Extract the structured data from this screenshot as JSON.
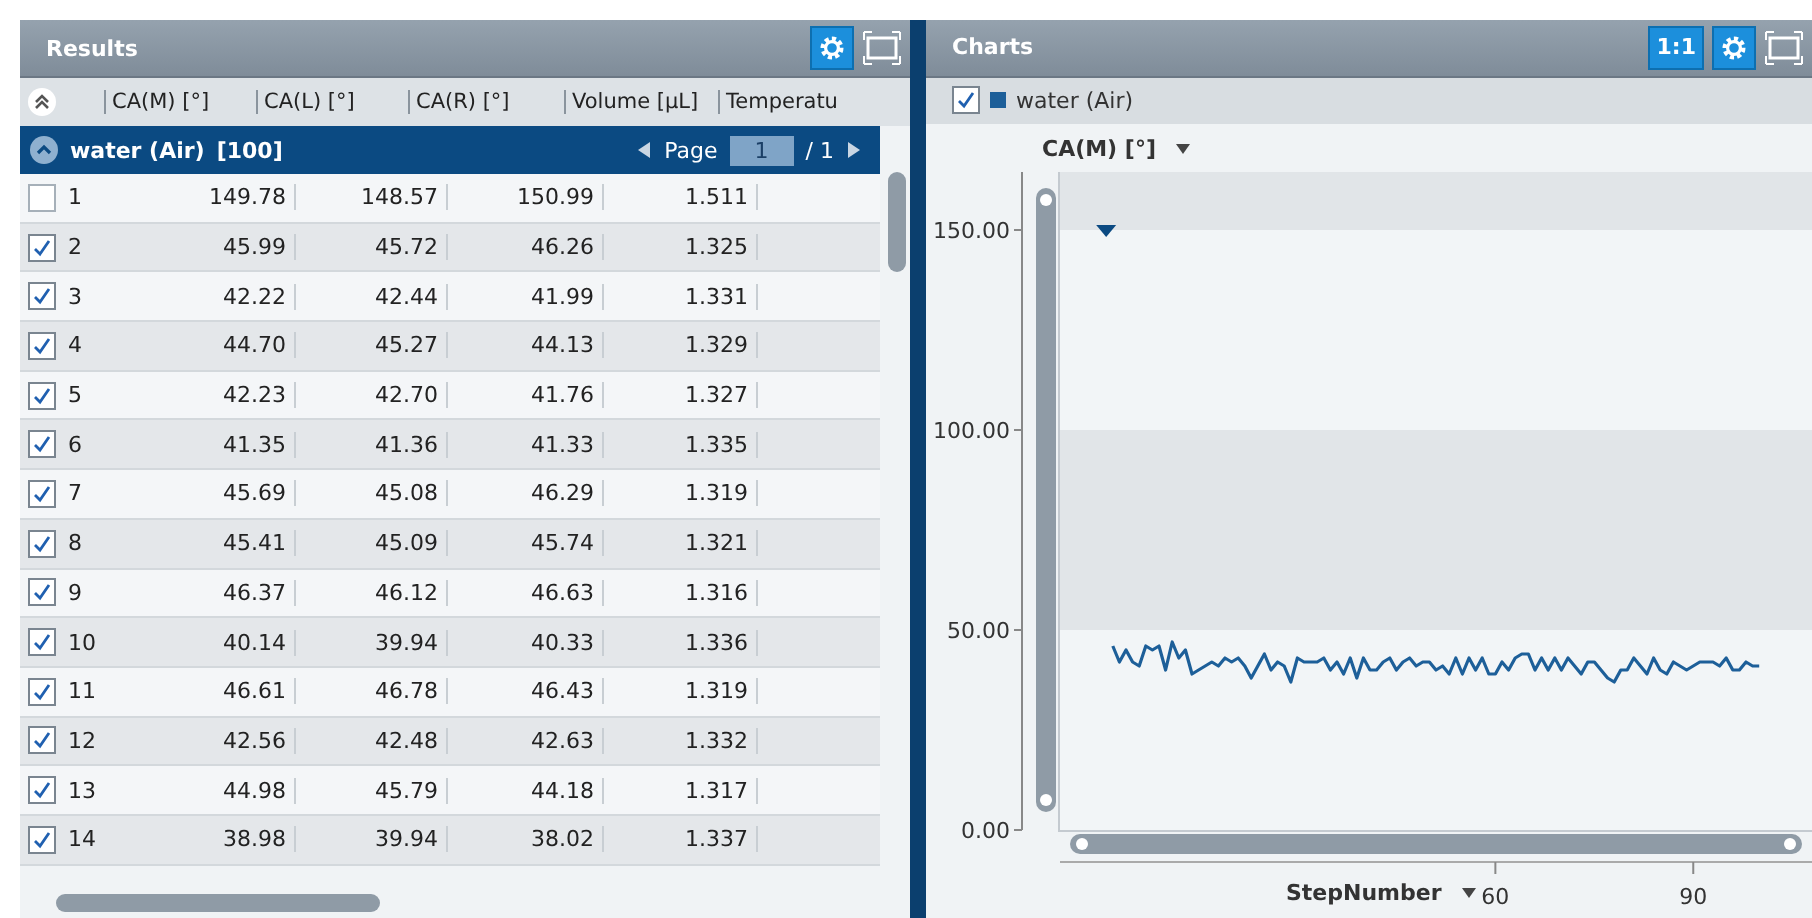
{
  "results_panel": {
    "title": "Results",
    "columns": [
      "CA(M) [°]",
      "CA(L) [°]",
      "CA(R) [°]",
      "Volume [µL]",
      "Temperatu"
    ],
    "group": {
      "label": "water (Air)",
      "count": "[100]",
      "page_label": "Page",
      "page": "1",
      "page_total": "/ 1"
    },
    "rows": [
      {
        "number": "1",
        "checked": false,
        "values": [
          "149.78",
          "148.57",
          "150.99",
          "1.511"
        ]
      },
      {
        "number": "2",
        "checked": true,
        "values": [
          "45.99",
          "45.72",
          "46.26",
          "1.325"
        ]
      },
      {
        "number": "3",
        "checked": true,
        "values": [
          "42.22",
          "42.44",
          "41.99",
          "1.331"
        ]
      },
      {
        "number": "4",
        "checked": true,
        "values": [
          "44.70",
          "45.27",
          "44.13",
          "1.329"
        ]
      },
      {
        "number": "5",
        "checked": true,
        "values": [
          "42.23",
          "42.70",
          "41.76",
          "1.327"
        ]
      },
      {
        "number": "6",
        "checked": true,
        "values": [
          "41.35",
          "41.36",
          "41.33",
          "1.335"
        ]
      },
      {
        "number": "7",
        "checked": true,
        "values": [
          "45.69",
          "45.08",
          "46.29",
          "1.319"
        ]
      },
      {
        "number": "8",
        "checked": true,
        "values": [
          "45.41",
          "45.09",
          "45.74",
          "1.321"
        ]
      },
      {
        "number": "9",
        "checked": true,
        "values": [
          "46.37",
          "46.12",
          "46.63",
          "1.316"
        ]
      },
      {
        "number": "10",
        "checked": true,
        "values": [
          "40.14",
          "39.94",
          "40.33",
          "1.336"
        ]
      },
      {
        "number": "11",
        "checked": true,
        "values": [
          "46.61",
          "46.78",
          "46.43",
          "1.319"
        ]
      },
      {
        "number": "12",
        "checked": true,
        "values": [
          "42.56",
          "42.48",
          "42.63",
          "1.332"
        ]
      },
      {
        "number": "13",
        "checked": true,
        "values": [
          "44.98",
          "45.79",
          "44.18",
          "1.317"
        ]
      },
      {
        "number": "14",
        "checked": true,
        "values": [
          "38.98",
          "39.94",
          "38.02",
          "1.337"
        ]
      }
    ]
  },
  "charts_panel": {
    "title": "Charts",
    "ratio_button": "1:1",
    "legend_checked": true,
    "y_selector": "CA(M) [°]",
    "x_selector": "StepNumber",
    "chart_data": {
      "type": "line",
      "xlim": [
        -6,
        108
      ],
      "ylim": [
        0,
        164.5
      ],
      "yticks": [
        {
          "value": 0,
          "label": "0.00"
        },
        {
          "value": 50,
          "label": "50.00"
        },
        {
          "value": 100,
          "label": "100.00"
        },
        {
          "value": 150,
          "label": "150.00"
        }
      ],
      "xticks": [
        60,
        90
      ],
      "x": [
        2,
        3,
        4,
        5,
        6,
        7,
        8,
        9,
        10,
        11,
        12,
        13,
        14,
        15,
        16,
        17,
        18,
        19,
        20,
        21,
        22,
        23,
        24,
        25,
        26,
        27,
        28,
        29,
        30,
        31,
        32,
        33,
        34,
        35,
        36,
        37,
        38,
        39,
        40,
        41,
        42,
        43,
        44,
        45,
        46,
        47,
        48,
        49,
        50,
        51,
        52,
        53,
        54,
        55,
        56,
        57,
        58,
        59,
        60,
        61,
        62,
        63,
        64,
        65,
        66,
        67,
        68,
        69,
        70,
        71,
        72,
        73,
        74,
        75,
        76,
        77,
        78,
        79,
        80,
        81,
        82,
        83,
        84,
        85,
        86,
        87,
        88,
        89,
        90,
        91,
        92,
        93,
        94,
        95,
        96,
        97,
        98,
        99,
        100
      ],
      "series": [
        {
          "name": "water (Air)",
          "color": "#1d5f99",
          "values": [
            46,
            42,
            45,
            42,
            41,
            46,
            45,
            46,
            40,
            47,
            43,
            45,
            39,
            40,
            41,
            42,
            41,
            43,
            42,
            43,
            41,
            38,
            41,
            44,
            40,
            42,
            41,
            37,
            43,
            42,
            42,
            42,
            43,
            40,
            42,
            39,
            43,
            38,
            43,
            40,
            40,
            42,
            43,
            40,
            42,
            43,
            41,
            42,
            42,
            40,
            41,
            39,
            43,
            39,
            43,
            40,
            43,
            39,
            39,
            42,
            40,
            43,
            44,
            44,
            40,
            43,
            40,
            43,
            40,
            43,
            41,
            39,
            42,
            42,
            40,
            38,
            37,
            40,
            40,
            43,
            41,
            39,
            43,
            40,
            39,
            42,
            41,
            40,
            41,
            42,
            42,
            42,
            41,
            43,
            40,
            40,
            42,
            41,
            41
          ]
        }
      ]
    }
  }
}
